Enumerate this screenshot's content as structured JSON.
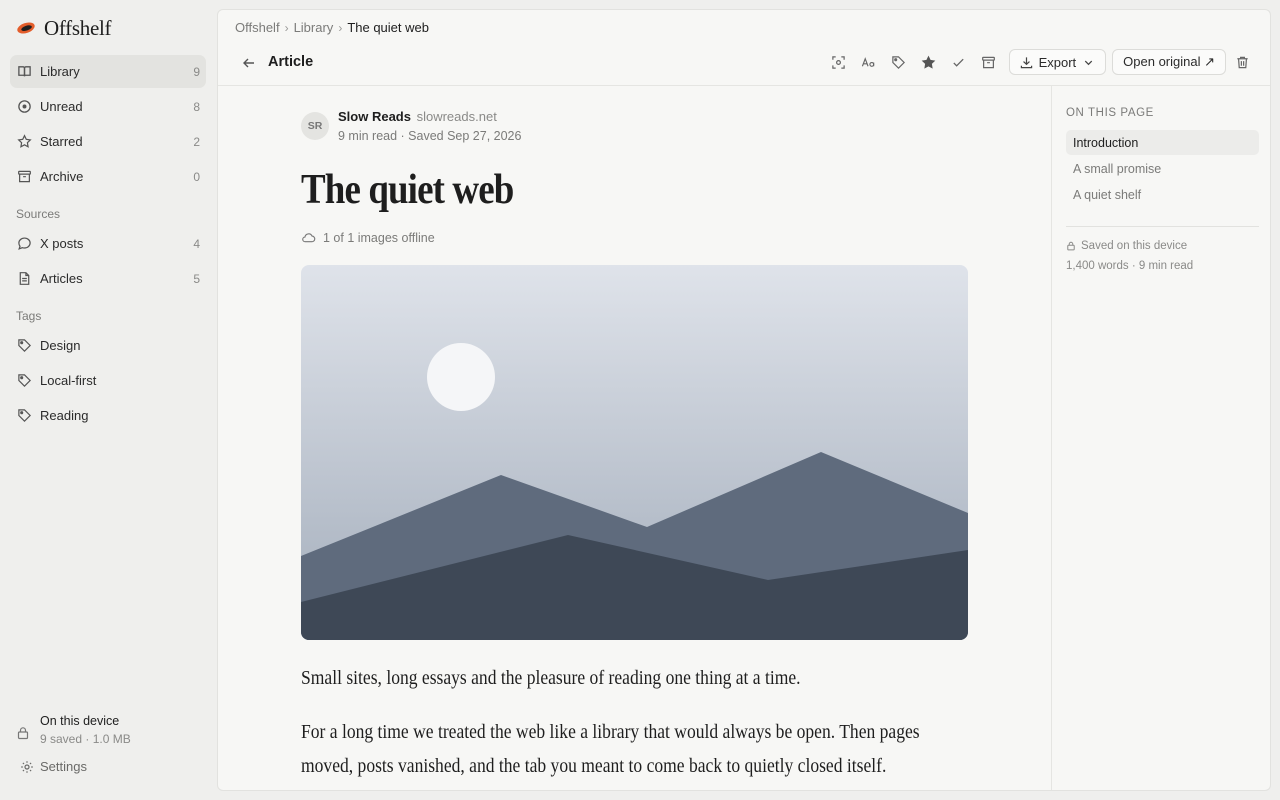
{
  "app": {
    "name": "Offshelf",
    "accent": "#e35d2b"
  },
  "sidebar": {
    "items": [
      {
        "label": "Library",
        "count": "9",
        "icon": "book-icon",
        "active": true
      },
      {
        "label": "Unread",
        "count": "8",
        "icon": "circle-dot-icon"
      },
      {
        "label": "Starred",
        "count": "2",
        "icon": "star-icon"
      },
      {
        "label": "Archive",
        "count": "0",
        "icon": "archive-icon"
      }
    ],
    "sources_label": "Sources",
    "sources": [
      {
        "label": "X posts",
        "count": "4",
        "icon": "chat-bubble-icon"
      },
      {
        "label": "Articles",
        "count": "5",
        "icon": "document-icon"
      }
    ],
    "tags_label": "Tags",
    "tags": [
      {
        "label": "Design",
        "icon": "tag-icon"
      },
      {
        "label": "Local-first",
        "icon": "tag-icon"
      },
      {
        "label": "Reading",
        "icon": "tag-icon"
      }
    ],
    "device": {
      "title": "On this device",
      "sub": "9 saved · 1.0 MB",
      "icon": "lock-icon"
    },
    "settings_label": "Settings"
  },
  "breadcrumb": {
    "root": "Offshelf",
    "section": "Library",
    "current": "The quiet web"
  },
  "toolbar": {
    "title": "Article",
    "export_label": "Export",
    "open_original_label": "Open original ↗"
  },
  "article": {
    "avatar": "SR",
    "author": "Slow Reads",
    "domain": "slowreads.net",
    "meta": "9 min read · Saved Sep 27, 2026",
    "title": "The quiet web",
    "offline": "1 of 1 images offline",
    "lead": "Small sites, long essays and the pleasure of reading one thing at a time.",
    "para1": "For a long time we treated the web like a library that would always be open. Then pages moved, posts vanished, and the tab you meant to come back to quietly closed itself."
  },
  "rail": {
    "heading": "ON THIS PAGE",
    "toc": [
      {
        "label": "Introduction",
        "active": true
      },
      {
        "label": "A small promise"
      },
      {
        "label": "A quiet shelf"
      }
    ],
    "saved": "Saved on this device",
    "words": "1,400 words · 9 min read"
  }
}
